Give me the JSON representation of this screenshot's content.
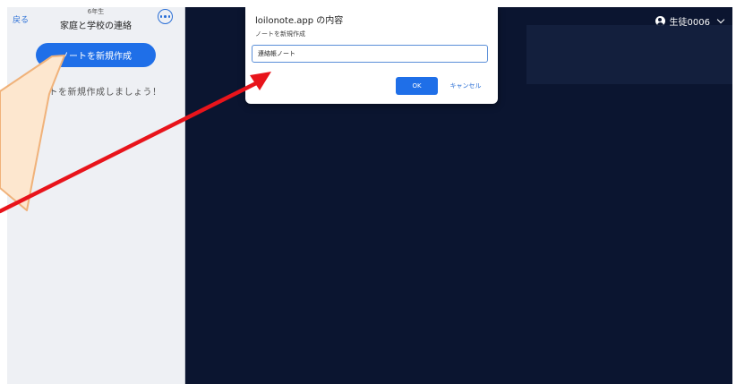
{
  "sidebar": {
    "back_label": "戻る",
    "grade_label": "6年生",
    "group_title": "家庭と学校の連絡",
    "create_button_label": "ノートを新規作成",
    "empty_hint": "ノートを新規作成しましょう！",
    "more_icon": "ellipsis-circle-icon"
  },
  "header": {
    "user_name": "生徒0006",
    "user_icon": "user-circle-icon",
    "menu_icon": "chevron-down-icon"
  },
  "dialog": {
    "title": "loilonote.app の内容",
    "message": "ノートを新規作成",
    "input_value": "連絡帳ノート",
    "ok_label": "OK",
    "cancel_label": "キャンセル"
  },
  "colors": {
    "background": "#0b1530",
    "accent": "#1f6fe8",
    "arrow": "#e8141b",
    "callout_fill": "#fde7cf",
    "callout_stroke": "#f0b27a"
  }
}
